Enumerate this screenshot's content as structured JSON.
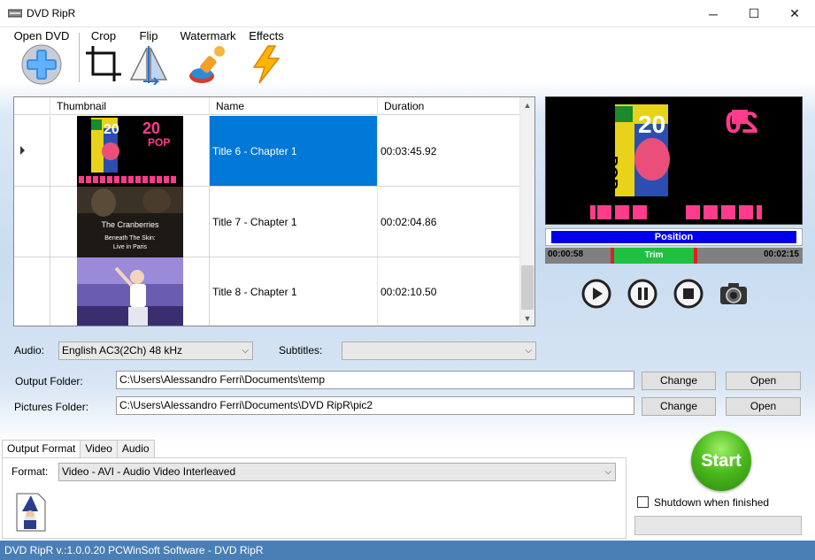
{
  "window": {
    "title": "DVD RipR",
    "minimize_glyph": "─",
    "maximize_glyph": "☐",
    "close_glyph": "✕"
  },
  "toolbar": {
    "open_dvd": "Open DVD",
    "crop": "Crop",
    "flip": "Flip",
    "watermark": "Watermark",
    "effects": "Effects"
  },
  "grid": {
    "columns": [
      "Thumbnail",
      "Name",
      "Duration"
    ],
    "rows": [
      {
        "name": "Title 6 - Chapter 1",
        "duration": "00:03:45.92",
        "selected": true
      },
      {
        "name": "Title 7 - Chapter 1",
        "duration": "00:02:04.86",
        "selected": false
      },
      {
        "name": "Title 8 - Chapter 1",
        "duration": "00:02:10.50",
        "selected": false
      }
    ],
    "thumb_texts": {
      "t1_top": "20",
      "t1_pop": "POP",
      "t2_line1": "The Cranberries",
      "t2_line2": "Beneath The Skin:",
      "t2_line3": "Live in Paris"
    }
  },
  "preview": {
    "number": "20",
    "pop": "POP",
    "mirror_number": "20"
  },
  "position_bar": {
    "label": "Position"
  },
  "trim_bar": {
    "start": "00:00:58",
    "label": "Trim",
    "end": "00:02:15"
  },
  "form": {
    "audio_label": "Audio:",
    "audio_value": "English AC3(2Ch) 48 kHz",
    "subtitles_label": "Subtitles:",
    "subtitles_value": "",
    "output_folder_label": "Output Folder:",
    "output_folder_value": "C:\\Users\\Alessandro Ferri\\Documents\\temp",
    "pictures_folder_label": "Pictures Folder:",
    "pictures_folder_value": "C:\\Users\\Alessandro Ferri\\Documents\\DVD RipR\\pic2",
    "change_label": "Change",
    "open_label": "Open"
  },
  "tabs": {
    "items": [
      "Output Format",
      "Video",
      "Audio"
    ],
    "active": "Output Format"
  },
  "format": {
    "label": "Format:",
    "value": "Video - AVI - Audio Video Interleaved"
  },
  "start": {
    "label": "Start"
  },
  "shutdown": {
    "label": "Shutdown when finished",
    "checked": false
  },
  "status": {
    "text": "DVD RipR v.:1.0.0.20 PCWinSoft Software - DVD RipR"
  },
  "colors": {
    "selection": "#0078d7",
    "position_fill": "#0000ee",
    "trim_green": "#20c040",
    "trim_marker": "#e02020",
    "statusbar": "#4a7fb5",
    "pink": "#ff3c8c"
  }
}
